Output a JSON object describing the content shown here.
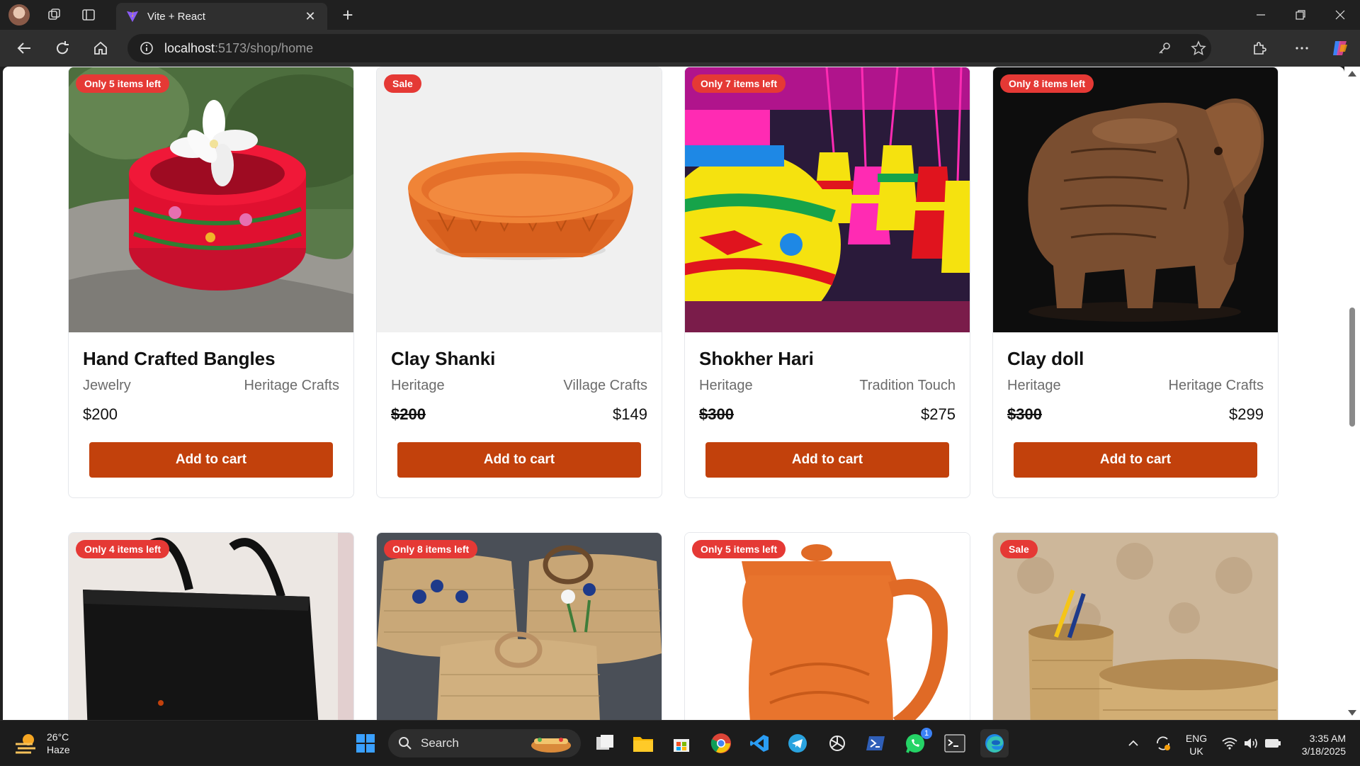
{
  "browser": {
    "tab_title": "Vite + React",
    "address_host": "localhost",
    "address_path": ":5173/shop/home"
  },
  "products": [
    {
      "name": "Hand Crafted Bangles",
      "category": "Jewelry",
      "seller": "Heritage Crafts",
      "old_price": "",
      "price": "$200",
      "badge": "Only 5 items left",
      "button": "Add to cart"
    },
    {
      "name": "Clay Shanki",
      "category": "Heritage",
      "seller": "Village Crafts",
      "old_price": "$200",
      "price": "$149",
      "badge": "Sale",
      "button": "Add to cart"
    },
    {
      "name": "Shokher Hari",
      "category": "Heritage",
      "seller": "Tradition Touch",
      "old_price": "$300",
      "price": "$275",
      "badge": "Only 7 items left",
      "button": "Add to cart"
    },
    {
      "name": "Clay doll",
      "category": "Heritage",
      "seller": "Heritage Crafts",
      "old_price": "$300",
      "price": "$299",
      "badge": "Only 8 items left",
      "button": "Add to cart"
    },
    {
      "badge": "Only 4 items left"
    },
    {
      "badge": "Only 8 items left"
    },
    {
      "badge": "Only 5 items left"
    },
    {
      "badge": "Sale"
    }
  ],
  "colors": {
    "accent_button": "#c2410c",
    "badge": "#e53935"
  },
  "taskbar": {
    "weather_temp": "26°C",
    "weather_desc": "Haze",
    "search_label": "Search",
    "whatsapp_badge": "1",
    "lang_1": "ENG",
    "lang_2": "UK",
    "time": "3:35 AM",
    "date": "3/18/2025"
  }
}
